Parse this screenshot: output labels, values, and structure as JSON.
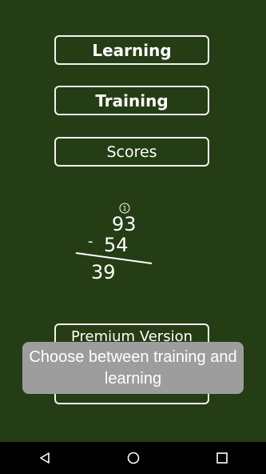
{
  "menu": {
    "learning_label": "Learning",
    "training_label": "Training",
    "scores_label": "Scores",
    "premium_label": "Premium Version"
  },
  "illustration": {
    "carry": "1",
    "top_number": "93",
    "operator": "-",
    "bottom_number": "54",
    "result": "39"
  },
  "toast": {
    "text": "Choose between training and learning"
  },
  "navbar": {
    "back_icon": "back-triangle-icon",
    "home_icon": "home-circle-icon",
    "recents_icon": "recents-square-icon"
  },
  "colors": {
    "background": "#253d14",
    "toast_bg": "#9d9d9d"
  }
}
